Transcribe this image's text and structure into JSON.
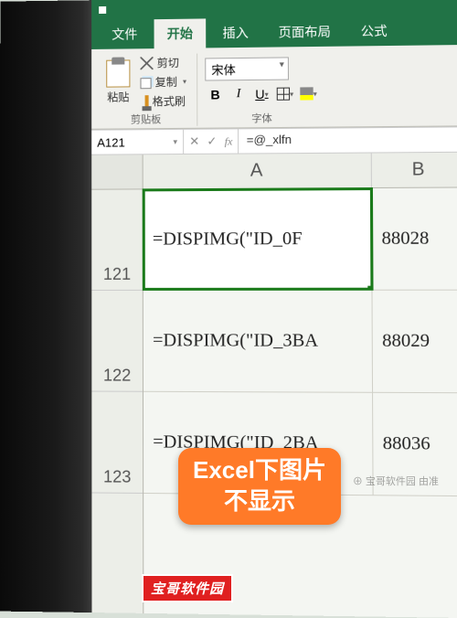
{
  "tabs": {
    "file": "文件",
    "home": "开始",
    "insert": "插入",
    "layout": "页面布局",
    "formula": "公式"
  },
  "clipboard": {
    "paste": "粘贴",
    "cut": "剪切",
    "copy": "复制",
    "painter": "格式刷",
    "group": "剪贴板"
  },
  "font": {
    "name": "宋体",
    "group": "字体",
    "bold": "B",
    "italic": "I",
    "underline": "U"
  },
  "namebox": "A121",
  "formula_bar": "=@_xlfn",
  "fx_cancel": "✕",
  "fx_ok": "✓",
  "fx": "fx",
  "cols": {
    "A": "A",
    "B": "B"
  },
  "rows": [
    "121",
    "122",
    "123"
  ],
  "cells": {
    "A121": "=DISPIMG(\"ID_0F",
    "B121": "88028",
    "A122": "=DISPIMG(\"ID_3BA",
    "B122": "88029",
    "A123": "=DISPIMG(\"ID_2BA",
    "B123": "88036"
  },
  "annotation": "Excel下图片\n不显示",
  "watermark": "宝哥软件园",
  "watermark2": "⊕ 宝哥软件园 由准"
}
